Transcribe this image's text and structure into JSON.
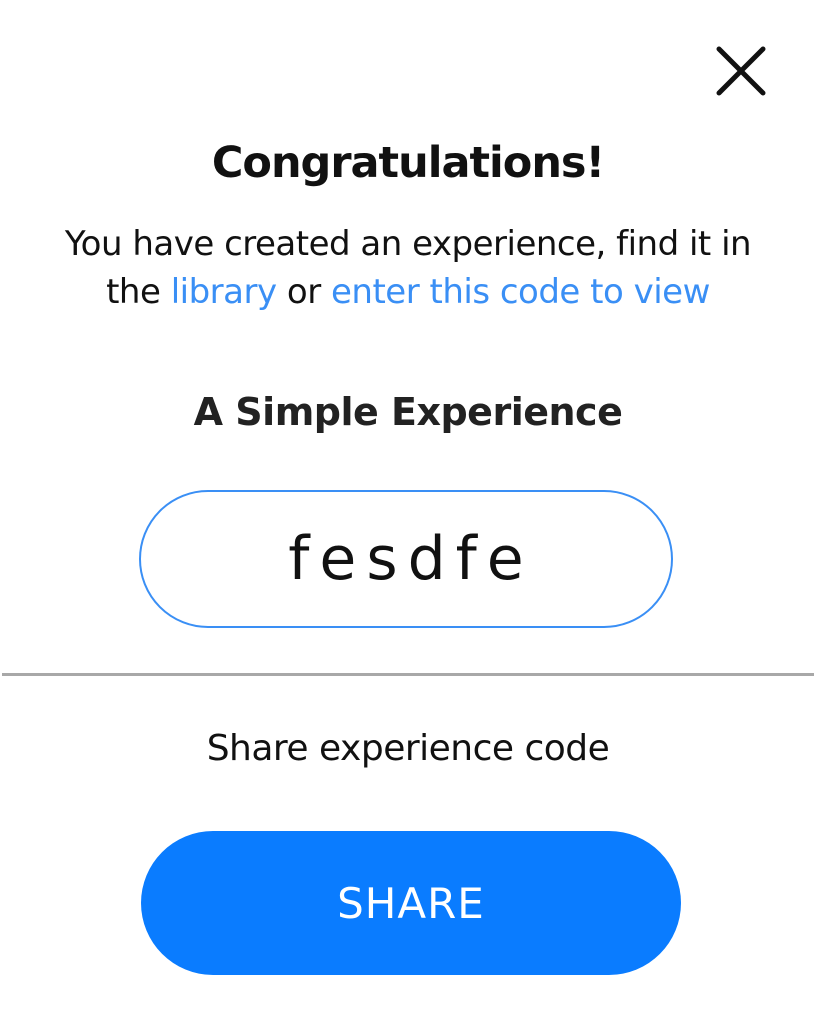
{
  "dialog": {
    "close_icon": "close-icon",
    "title": "Congratulations!",
    "message": {
      "part1": "You have created an experience, find it in the ",
      "library_link": "library",
      "part2": " or ",
      "code_link": "enter this code to view"
    },
    "experience_name": "A Simple Experience",
    "experience_code": "fesdfe",
    "share_caption": "Share experience code",
    "share_button_label": "SHARE"
  },
  "colors": {
    "accent": "#0a7cff",
    "link": "#3a8ff5",
    "divider": "#a8a8a8"
  }
}
